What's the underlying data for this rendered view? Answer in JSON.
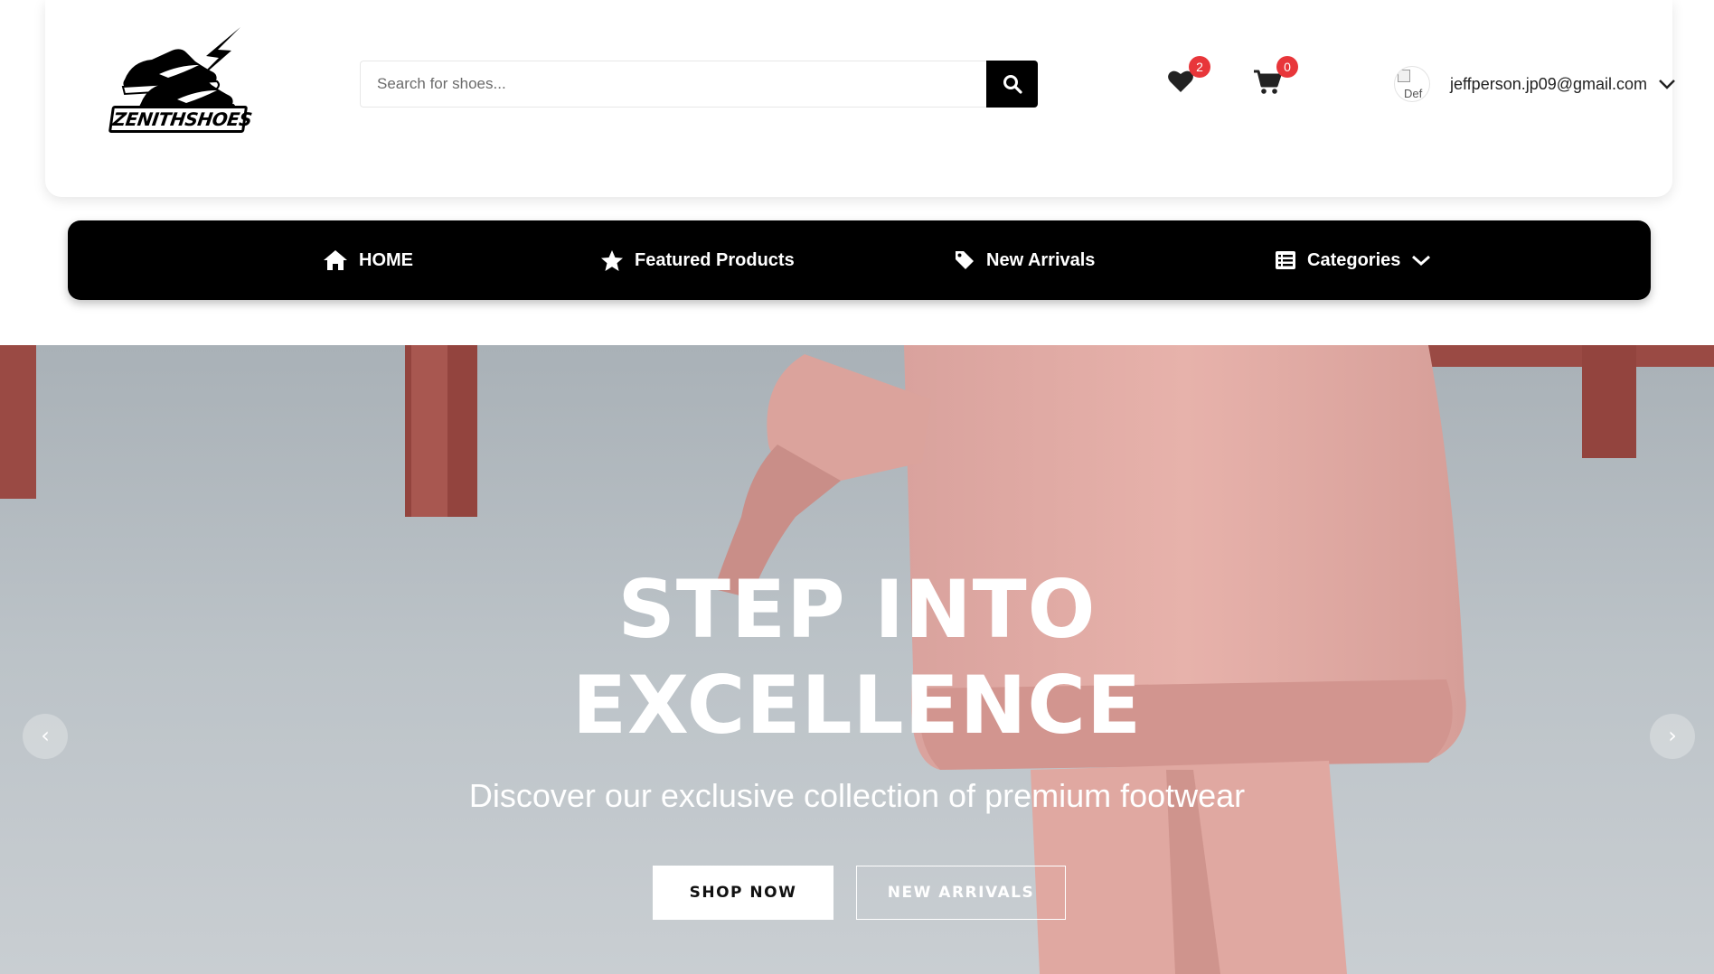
{
  "brand": {
    "name": "ZENITHSHOES"
  },
  "search": {
    "placeholder": "Search for shoes..."
  },
  "header": {
    "wishlist_count": "2",
    "cart_count": "0",
    "avatar_alt": "Def",
    "user_email": "jeffperson.jp09@gmail.com"
  },
  "nav": {
    "items": [
      {
        "label": "HOME",
        "icon": "home-icon"
      },
      {
        "label": "Featured Products",
        "icon": "star-icon"
      },
      {
        "label": "New Arrivals",
        "icon": "tag-icon"
      },
      {
        "label": "Categories",
        "icon": "list-icon"
      }
    ]
  },
  "hero": {
    "title_line1": "STEP INTO",
    "title_line2": "EXCELLENCE",
    "subtitle": "Discover our exclusive collection of premium footwear",
    "primary_button": "SHOP NOW",
    "secondary_button": "NEW ARRIVALS",
    "prev_arrow": "‹",
    "next_arrow": "›"
  },
  "colors": {
    "nav_background": "#000000",
    "badge": "#e8363a",
    "primary_text": "#111111"
  }
}
